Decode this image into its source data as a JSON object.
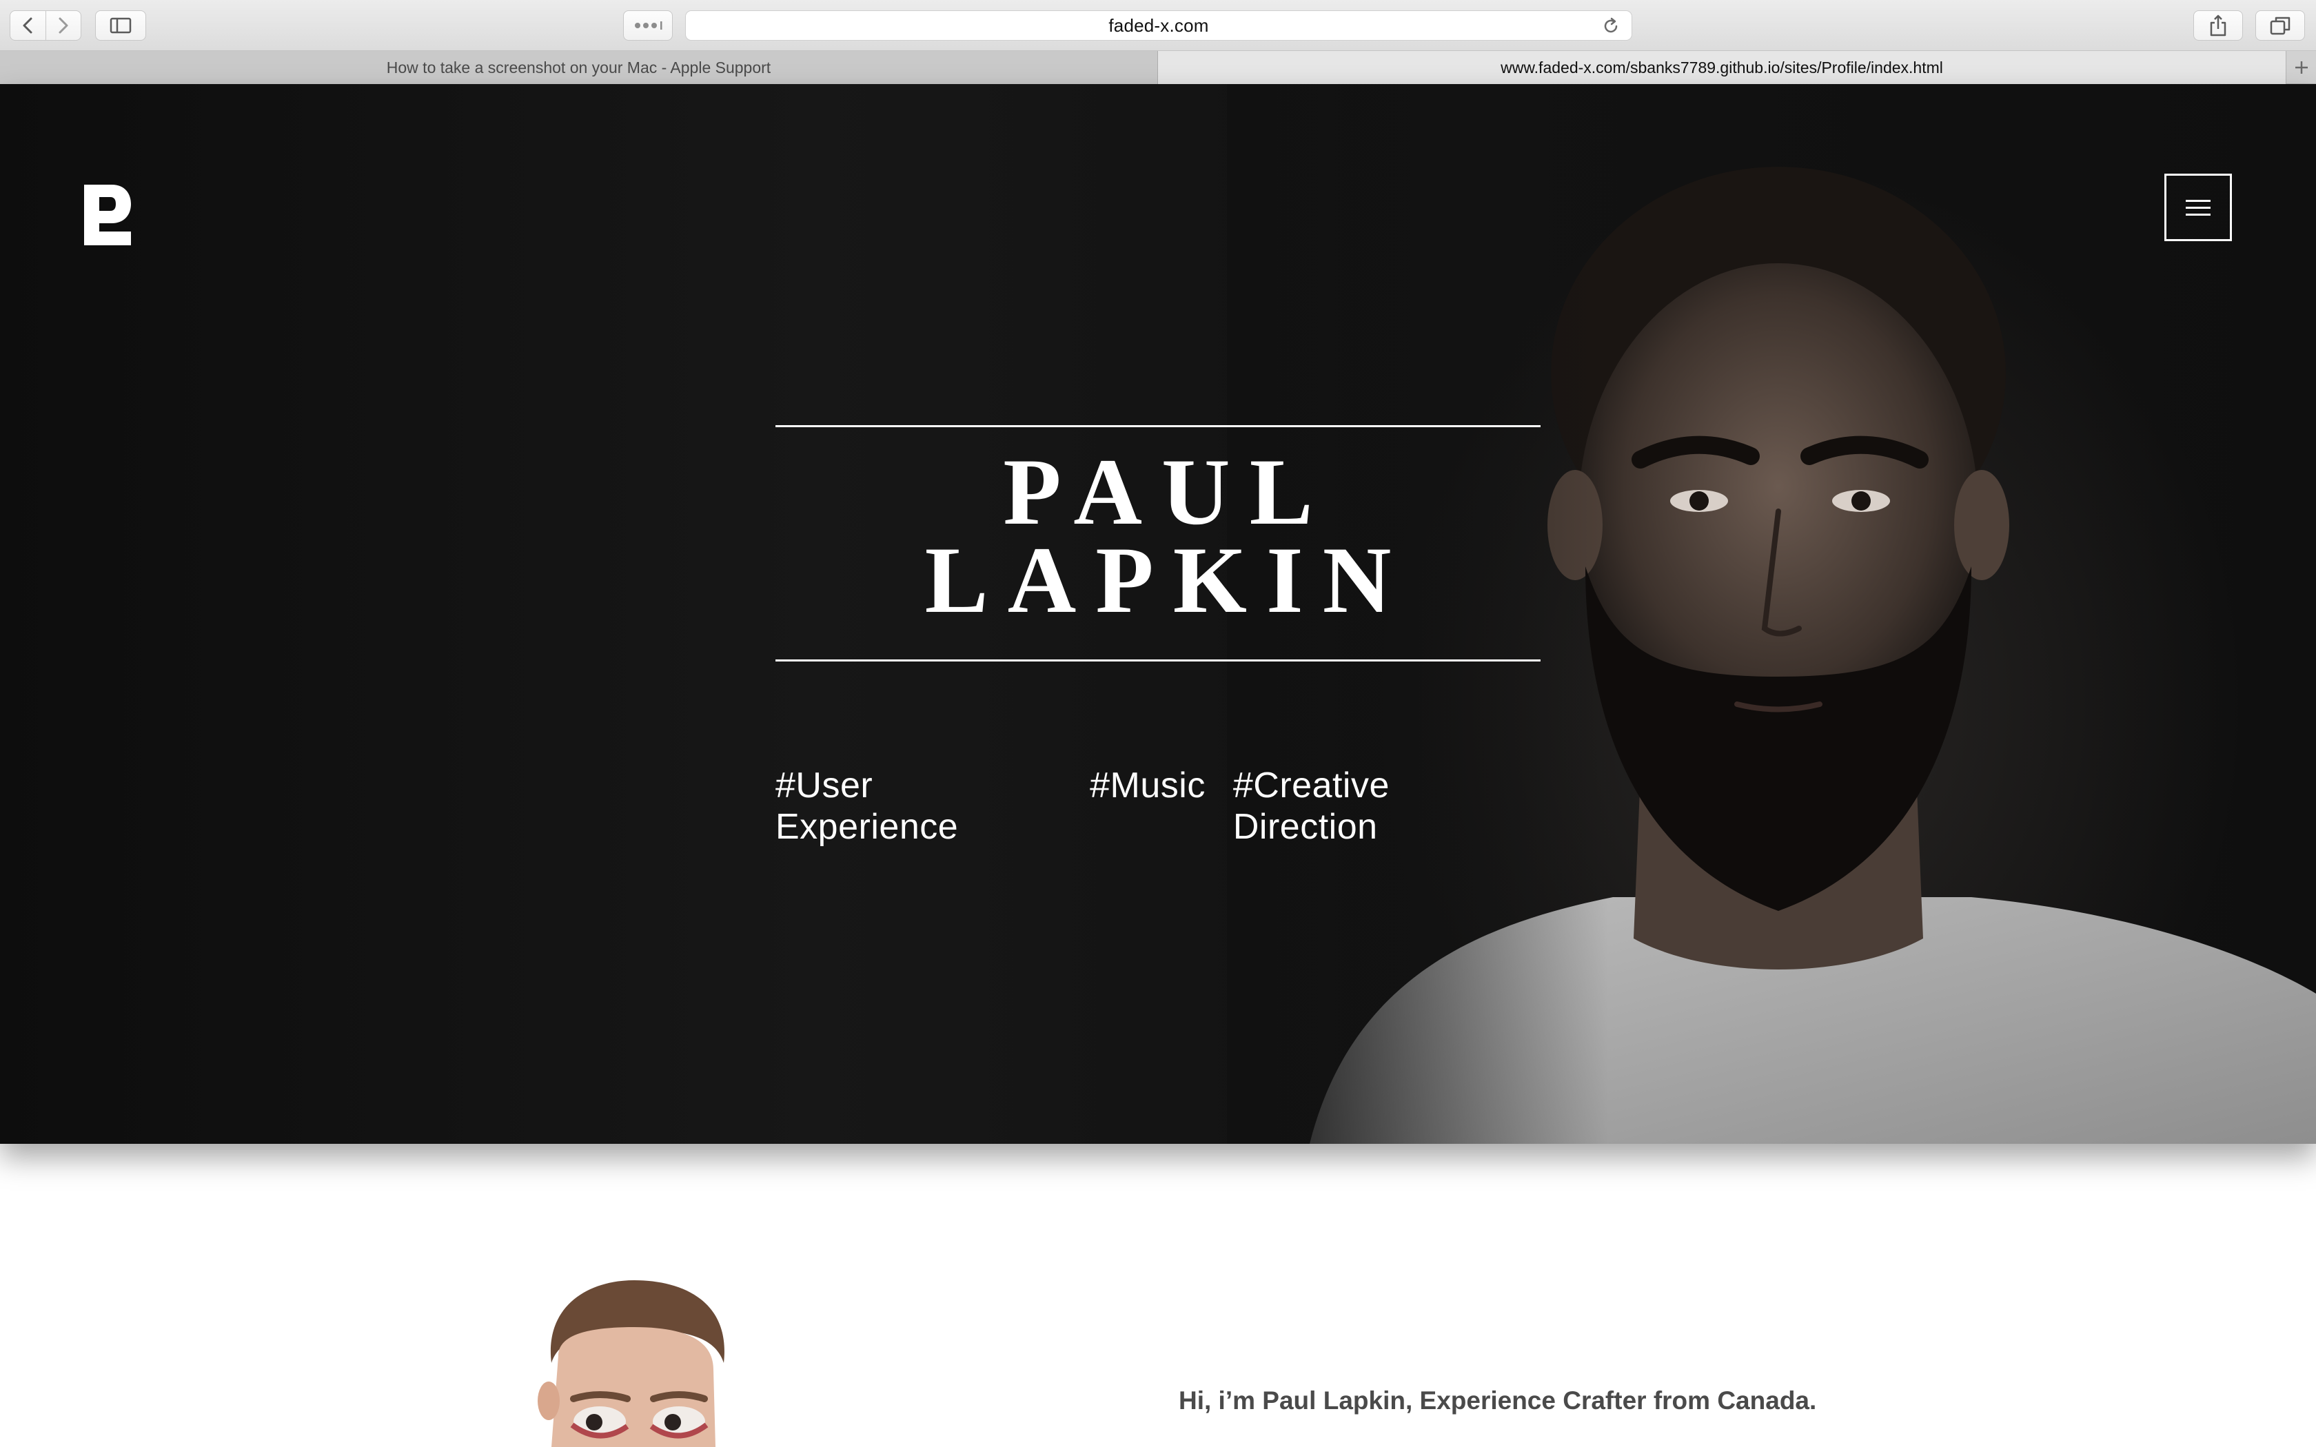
{
  "browser": {
    "address": "faded-x.com",
    "tabs": [
      {
        "label": "How to take a screenshot on your Mac - Apple Support",
        "active": false
      },
      {
        "label": "www.faded-x.com/sbanks7789.github.io/sites/Profile/index.html",
        "active": true
      }
    ]
  },
  "hero": {
    "name_line1": "PAUL",
    "name_line2": "LAPKIN",
    "hashtags": [
      "#User Experience",
      "#Music",
      "#Creative Direction"
    ]
  },
  "about": {
    "intro": "Hi, i’m Paul Lapkin, Experience Crafter from Canada."
  },
  "colors": {
    "hero_bg": "#121212",
    "hero_text": "#ffffff",
    "intro_text": "#4a4a4a",
    "chrome_bg": "#e2e2e2"
  },
  "icons": [
    "back-arrow-icon",
    "forward-arrow-icon",
    "sidebar-icon",
    "reader-icon",
    "reload-icon",
    "share-icon",
    "tabs-overview-icon",
    "plus-icon",
    "logo-mark",
    "hamburger-menu-icon"
  ]
}
